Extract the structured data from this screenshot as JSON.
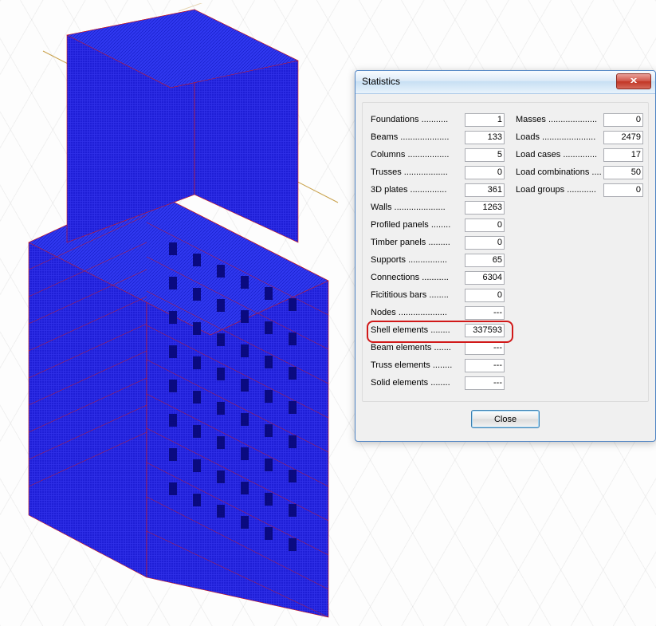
{
  "dialog": {
    "title": "Statistics",
    "close_glyph": "x",
    "close_button_label": "Close",
    "left_column": [
      {
        "label": "Foundations ...........",
        "value": "1"
      },
      {
        "label": "Beams ....................",
        "value": "133"
      },
      {
        "label": "Columns .................",
        "value": "5"
      },
      {
        "label": "Trusses ..................",
        "value": "0"
      },
      {
        "label": "3D plates ...............",
        "value": "361"
      },
      {
        "label": "Walls .....................",
        "value": "1263"
      },
      {
        "label": "Profiled panels ........",
        "value": "0"
      },
      {
        "label": "Timber panels .........",
        "value": "0"
      },
      {
        "label": "Supports ................",
        "value": "65"
      },
      {
        "label": "Connections ...........",
        "value": "6304"
      },
      {
        "label": "Ficititious bars ........",
        "value": "0"
      },
      {
        "label": "Nodes ....................",
        "value": "---"
      },
      {
        "label": "Shell elements ........",
        "value": "337593",
        "highlight": true
      },
      {
        "label": "Beam elements .......",
        "value": "---"
      },
      {
        "label": "Truss elements ........",
        "value": "---"
      },
      {
        "label": "Solid elements ........",
        "value": "---"
      }
    ],
    "right_column": [
      {
        "label": "Masses ....................",
        "value": "0"
      },
      {
        "label": "Loads ......................",
        "value": "2479"
      },
      {
        "label": "Load cases ..............",
        "value": "17"
      },
      {
        "label": "Load combinations ....",
        "value": "50"
      },
      {
        "label": "Load groups ............",
        "value": "0"
      }
    ]
  }
}
